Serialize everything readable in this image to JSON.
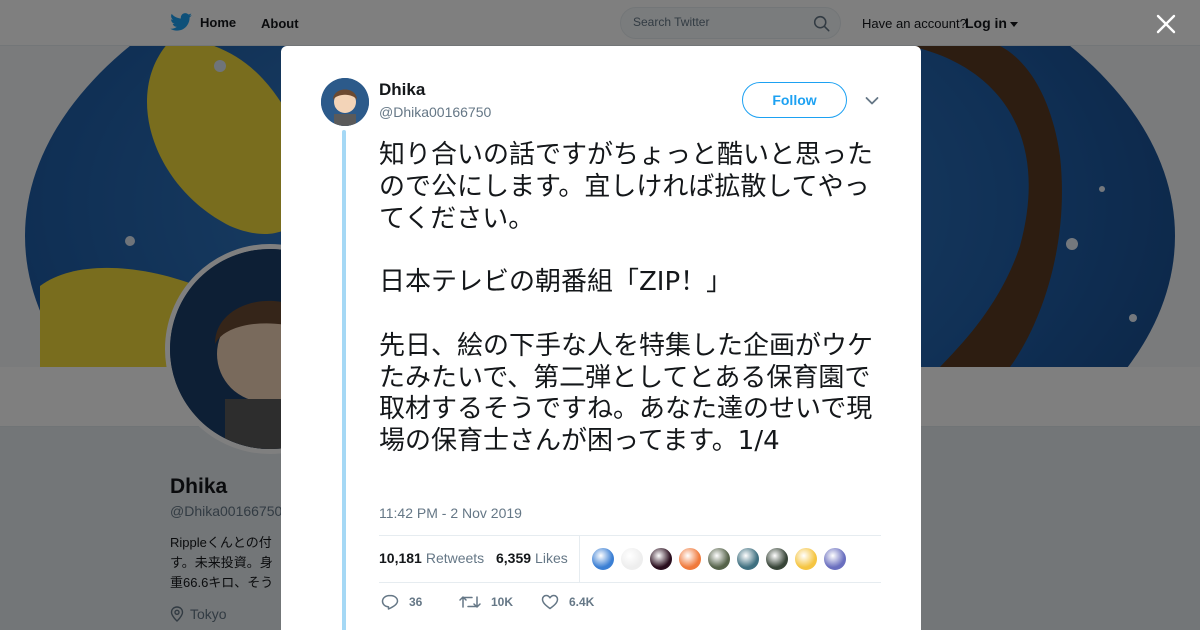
{
  "nav": {
    "home_label": "Home",
    "about_label": "About",
    "search_placeholder": "Search Twitter",
    "account_prompt": "Have an account?",
    "login_label": "Log in",
    "icons": [
      "twitter-bird-icon",
      "search-icon",
      "chevron-down-icon"
    ]
  },
  "profile_bg": {
    "name": "Dhika",
    "handle": "@Dhika00166750",
    "bio": "Rippleくんとの付\nす。未来投資。身\n重66.6キロ、そう",
    "location": "Tokyo"
  },
  "tweet": {
    "author_name": "Dhika",
    "author_handle": "@Dhika00166750",
    "follow_label": "Follow",
    "text": "知り合いの話ですがちょっと酷いと思ったので公にします。宜しければ拡散してやってください。\n\n日本テレビの朝番組「ZIP！」\n\n先日、絵の下手な人を特集した企画がウケたみたいで、第二弾としてとある保育園で取材するそうですね。あなた達のせいで現場の保育士さんが困ってます。1/4",
    "timestamp": "11:42 PM - 2 Nov 2019",
    "retweets_count": "10,181",
    "retweets_label": "Retweets",
    "likes_count": "6,359",
    "likes_label": "Likes",
    "reply_count": "36",
    "retweet_action_count": "10K",
    "like_action_count": "6.4K"
  },
  "likers": [
    {
      "name": "liker-1",
      "color": "#3b7fd4"
    },
    {
      "name": "liker-2",
      "color": "#eeeeee"
    },
    {
      "name": "liker-3",
      "color": "#2a0e1e"
    },
    {
      "name": "liker-4",
      "color": "#f07a3c"
    },
    {
      "name": "liker-5",
      "color": "#56634a"
    },
    {
      "name": "liker-6",
      "color": "#3f7080"
    },
    {
      "name": "liker-7",
      "color": "#384538"
    },
    {
      "name": "liker-8",
      "color": "#f5c542"
    },
    {
      "name": "liker-9",
      "color": "#6a6fbf"
    }
  ],
  "colors": {
    "twitter_blue": "#1da1f2",
    "thread_line": "#a5d8f5",
    "text_primary": "#14171a",
    "text_secondary": "#657786",
    "overlay": "rgba(0,0,0,0.5)"
  }
}
